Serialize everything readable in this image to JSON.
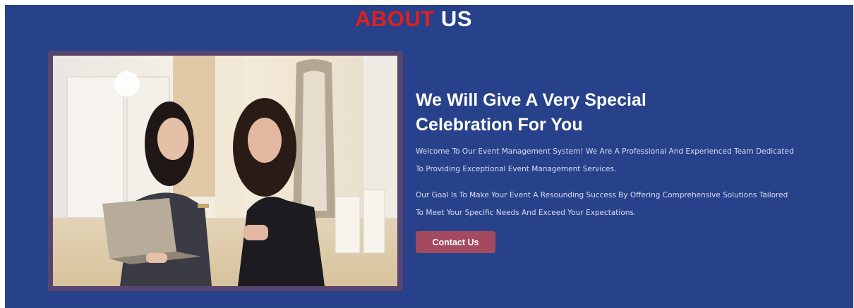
{
  "about": {
    "heading_accent": "ABOUT",
    "heading_rest": " US",
    "title_line1": "We Will Give A Very Special",
    "title_line2": "Celebration For You",
    "paragraph1": "Welcome To Our Event Management System! We Are A Professional And Experienced Team Dedicated To Providing Exceptional Event Management Services.",
    "paragraph2": "Our Goal Is To Make Your Event A Resounding Success By Offering Comprehensive Solutions Tailored To Meet Your Specific Needs And Exceed Your Expectations.",
    "cta_label": "Contact Us"
  },
  "colors": {
    "background": "#27418a",
    "accent": "#e0201c",
    "frame": "#56466f",
    "button": "#a44a5e"
  }
}
